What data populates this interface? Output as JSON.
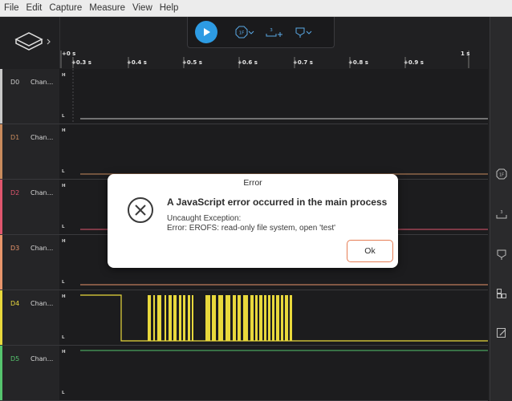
{
  "menu": [
    "File",
    "Edit",
    "Capture",
    "Measure",
    "View",
    "Help"
  ],
  "toolbar": {
    "play_label": "Start capture",
    "trigger_label": "1F",
    "measure_label": "3",
    "marker_label": "Markers"
  },
  "timeline": {
    "labels": [
      "+0 s",
      "+0.3 s",
      "+0.4 s",
      "+0.5 s",
      "+0.6 s",
      "+0.7 s",
      "+0.8 s",
      "+0.9 s",
      "1 s"
    ]
  },
  "channels": [
    {
      "id": "D0",
      "name": "Chan...",
      "color": "#c8c8c8"
    },
    {
      "id": "D1",
      "name": "Chan...",
      "color": "#c98b5d"
    },
    {
      "id": "D2",
      "name": "Chan...",
      "color": "#e0566e"
    },
    {
      "id": "D3",
      "name": "Chan...",
      "color": "#e8956b"
    },
    {
      "id": "D4",
      "name": "Chan...",
      "color": "#e8d83c"
    },
    {
      "id": "D5",
      "name": "Chan...",
      "color": "#55c46e"
    }
  ],
  "lane_labels": {
    "high": "H",
    "low": "L"
  },
  "rail": {
    "trigger": "1F",
    "measure": "3"
  },
  "dialog": {
    "title": "Error",
    "heading": "A JavaScript error occurred in the main process",
    "line1": "Uncaught Exception:",
    "line2": "Error: EROFS: read-only file system, open 'test'",
    "ok": "Ok"
  }
}
